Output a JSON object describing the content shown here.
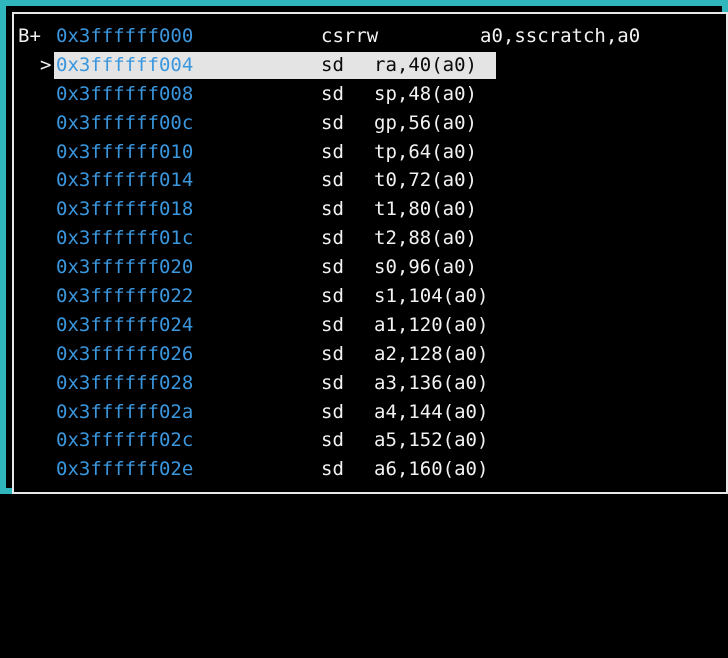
{
  "window": {
    "border_color": "#2fb7bd"
  },
  "colors": {
    "address": "#3a96dd",
    "text": "#f2f2f2",
    "highlight": "#e4e4e4",
    "background": "#000000"
  },
  "rows": [
    {
      "marker": "B+",
      "cursor": "",
      "address": "0x3ffffff000",
      "mnemonic": "csrrw",
      "operands": "a0,sscratch,a0"
    },
    {
      "marker": "",
      "cursor": ">",
      "address": "0x3ffffff004",
      "mnemonic": "sd",
      "operands": "ra,40(a0)"
    },
    {
      "marker": "",
      "cursor": "",
      "address": "0x3ffffff008",
      "mnemonic": "sd",
      "operands": "sp,48(a0)"
    },
    {
      "marker": "",
      "cursor": "",
      "address": "0x3ffffff00c",
      "mnemonic": "sd",
      "operands": "gp,56(a0)"
    },
    {
      "marker": "",
      "cursor": "",
      "address": "0x3ffffff010",
      "mnemonic": "sd",
      "operands": "tp,64(a0)"
    },
    {
      "marker": "",
      "cursor": "",
      "address": "0x3ffffff014",
      "mnemonic": "sd",
      "operands": "t0,72(a0)"
    },
    {
      "marker": "",
      "cursor": "",
      "address": "0x3ffffff018",
      "mnemonic": "sd",
      "operands": "t1,80(a0)"
    },
    {
      "marker": "",
      "cursor": "",
      "address": "0x3ffffff01c",
      "mnemonic": "sd",
      "operands": "t2,88(a0)"
    },
    {
      "marker": "",
      "cursor": "",
      "address": "0x3ffffff020",
      "mnemonic": "sd",
      "operands": "s0,96(a0)"
    },
    {
      "marker": "",
      "cursor": "",
      "address": "0x3ffffff022",
      "mnemonic": "sd",
      "operands": "s1,104(a0)"
    },
    {
      "marker": "",
      "cursor": "",
      "address": "0x3ffffff024",
      "mnemonic": "sd",
      "operands": "a1,120(a0)"
    },
    {
      "marker": "",
      "cursor": "",
      "address": "0x3ffffff026",
      "mnemonic": "sd",
      "operands": "a2,128(a0)"
    },
    {
      "marker": "",
      "cursor": "",
      "address": "0x3ffffff028",
      "mnemonic": "sd",
      "operands": "a3,136(a0)"
    },
    {
      "marker": "",
      "cursor": "",
      "address": "0x3ffffff02a",
      "mnemonic": "sd",
      "operands": "a4,144(a0)"
    },
    {
      "marker": "",
      "cursor": "",
      "address": "0x3ffffff02c",
      "mnemonic": "sd",
      "operands": "a5,152(a0)"
    },
    {
      "marker": "",
      "cursor": "",
      "address": "0x3ffffff02e",
      "mnemonic": "sd",
      "operands": "a6,160(a0)"
    }
  ]
}
